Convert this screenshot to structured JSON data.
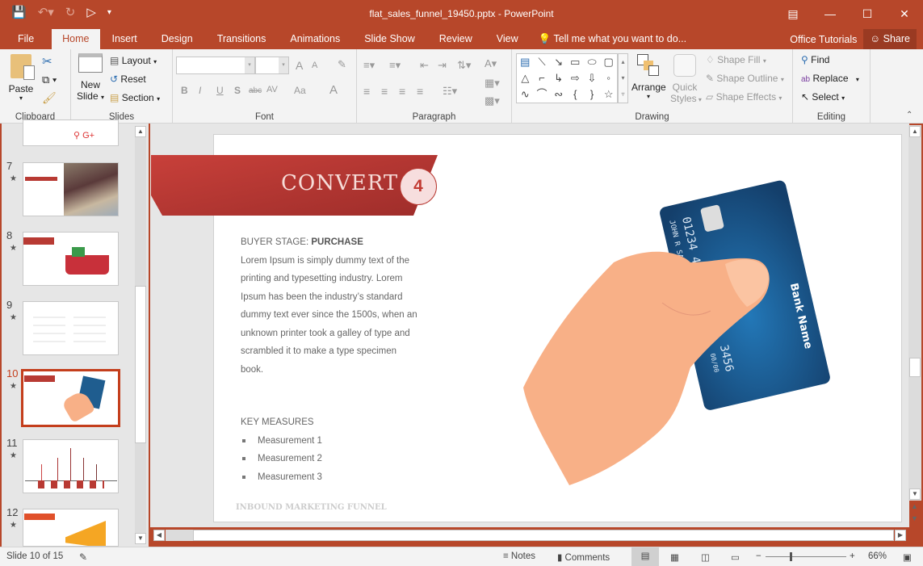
{
  "window": {
    "title": "flat_sales_funnel_19450.pptx - PowerPoint"
  },
  "qat": {
    "save": "save-icon",
    "undo": "undo-icon",
    "redo": "redo-icon",
    "present": "start-from-beginning-icon",
    "customize": "customize-qat-icon"
  },
  "window_controls": {
    "restore_ribbon": "ribbon-display-options-icon",
    "minimize": "—",
    "maximize": "☐",
    "close": "✕"
  },
  "tabs": [
    {
      "label": "File"
    },
    {
      "label": "Home"
    },
    {
      "label": "Insert"
    },
    {
      "label": "Design"
    },
    {
      "label": "Transitions"
    },
    {
      "label": "Animations"
    },
    {
      "label": "Slide Show"
    },
    {
      "label": "Review"
    },
    {
      "label": "View"
    }
  ],
  "tell_me": "Tell me what you want to do...",
  "office_tutorials": "Office Tutorials",
  "share": "Share",
  "ribbon": {
    "clipboard": {
      "label": "Clipboard",
      "paste": "Paste"
    },
    "slides": {
      "label": "Slides",
      "new_slide_1": "New",
      "new_slide_2": "Slide",
      "layout": "Layout",
      "reset": "Reset",
      "section": "Section"
    },
    "font": {
      "label": "Font",
      "font_name": "",
      "font_size": "",
      "bold": "B",
      "italic": "I",
      "underline": "U",
      "shadow": "S",
      "strike": "abc",
      "spacing": "AV",
      "case": "Aa",
      "color": "A",
      "grow": "A",
      "shrink": "A"
    },
    "paragraph": {
      "label": "Paragraph"
    },
    "drawing": {
      "label": "Drawing",
      "arrange": "Arrange",
      "quick_styles_1": "Quick",
      "quick_styles_2": "Styles",
      "shape_fill": "Shape Fill",
      "shape_outline": "Shape Outline",
      "shape_effects": "Shape Effects"
    },
    "editing": {
      "label": "Editing",
      "find": "Find",
      "replace": "Replace",
      "select": "Select"
    }
  },
  "thumbnails": [
    {
      "num": "7",
      "selected": false
    },
    {
      "num": "8",
      "selected": false
    },
    {
      "num": "9",
      "selected": false
    },
    {
      "num": "10",
      "selected": true
    },
    {
      "num": "11",
      "selected": false
    },
    {
      "num": "12",
      "selected": false
    }
  ],
  "slide": {
    "title": "CONVERT",
    "number": "4",
    "buyer_stage_label": "BUYER STAGE: ",
    "buyer_stage_value": "PURCHASE",
    "body": "Lorem Ipsum is simply dummy text of the printing and typesetting industry. Lorem Ipsum has been the industry’s standard dummy text ever since the 1500s, when an unknown printer took a galley of type and scrambled it to make a type specimen book.",
    "key_measures_title": "KEY MEASURES",
    "measures": [
      "Measurement 1",
      "Measurement 2",
      "Measurement 3"
    ],
    "footer": "INBOUND MARKETING FUNNEL",
    "card": {
      "number_top": "01234 45",
      "number_bottom": "3456",
      "expiry": "00/00",
      "holder": "JOHN R SAMPLE",
      "bank": "Bank Name"
    },
    "colors": {
      "banner": "#b83a33",
      "card": "#1f5d8f",
      "skin": "#f8b087"
    }
  },
  "status": {
    "slide_info": "Slide 10 of 15",
    "notes": "Notes",
    "comments": "Comments",
    "zoom": "66%"
  },
  "zoom_level_percent": 66
}
